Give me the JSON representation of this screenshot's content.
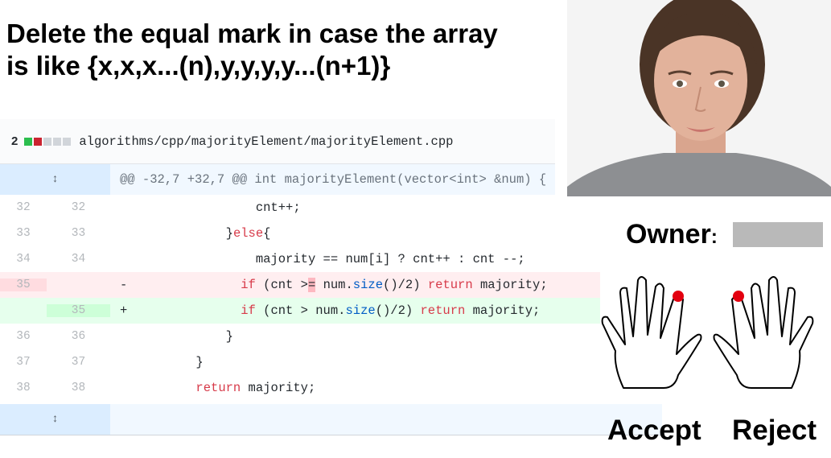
{
  "headline": "Delete the equal mark in case the array\nis like {x,x,x...(n),y,y,y,y...(n+1)}",
  "diff": {
    "changes_count": "2",
    "file_path": "algorithms/cpp/majorityElement/majorityElement.cpp",
    "hunk_header": "@@ -32,7 +32,7 @@ int majorityElement(vector<int> &num) {",
    "lines": [
      {
        "type": "ctx",
        "old": "32",
        "new": "32",
        "indent": "                ",
        "parts": [
          [
            "",
            "cnt++;"
          ]
        ]
      },
      {
        "type": "ctx",
        "old": "33",
        "new": "33",
        "indent": "            ",
        "parts": [
          [
            "",
            "}"
          ],
          [
            "kw",
            "else"
          ],
          [
            "",
            "{"
          ]
        ]
      },
      {
        "type": "ctx",
        "old": "34",
        "new": "34",
        "indent": "                ",
        "parts": [
          [
            "",
            "majority == num[i] ? cnt++ : cnt --;"
          ]
        ]
      },
      {
        "type": "del",
        "old": "35",
        "new": "",
        "sign": "-",
        "indent": "              ",
        "parts": [
          [
            "kw",
            "if"
          ],
          [
            "",
            " (cnt >"
          ],
          [
            "hl",
            "="
          ],
          [
            "",
            " num."
          ],
          [
            "fn",
            "size"
          ],
          [
            "",
            "()/2) "
          ],
          [
            "kw",
            "return"
          ],
          [
            "",
            " majority;"
          ]
        ]
      },
      {
        "type": "add",
        "old": "",
        "new": "35",
        "sign": "+",
        "indent": "              ",
        "parts": [
          [
            "kw",
            "if"
          ],
          [
            "",
            " (cnt > num."
          ],
          [
            "fn",
            "size"
          ],
          [
            "",
            "()/2) "
          ],
          [
            "kw",
            "return"
          ],
          [
            "",
            " majority;"
          ]
        ]
      },
      {
        "type": "ctx",
        "old": "36",
        "new": "36",
        "indent": "            ",
        "parts": [
          [
            "",
            "}"
          ]
        ]
      },
      {
        "type": "ctx",
        "old": "37",
        "new": "37",
        "indent": "        ",
        "parts": [
          [
            "",
            "}"
          ]
        ]
      },
      {
        "type": "ctx",
        "old": "38",
        "new": "38",
        "indent": "        ",
        "parts": [
          [
            "kw",
            "return"
          ],
          [
            "",
            " majority;"
          ]
        ]
      }
    ]
  },
  "owner_label": "Owner",
  "owner_colon": ":",
  "accept_label": "Accept",
  "reject_label": "Reject",
  "colors": {
    "added_block": "#2cbe4e",
    "removed_block": "#cb2431",
    "neutral_block": "#d1d5da",
    "finger_dot": "#e3000f"
  },
  "icons": {
    "expand": "unfold-icon",
    "accept_hand": "left-hand-icon",
    "reject_hand": "right-hand-icon"
  }
}
